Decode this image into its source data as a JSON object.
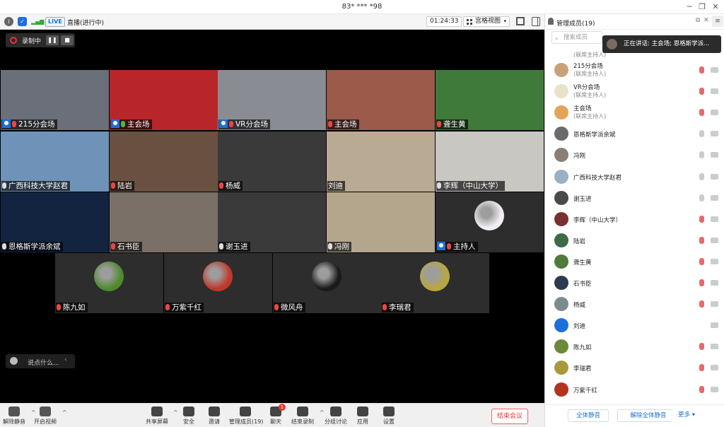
{
  "window": {
    "title": "83* *** *98"
  },
  "topbar": {
    "live_badge": "LIVE",
    "live_status": "直播(进行中)",
    "timer": "01:24:33",
    "view_mode": "宫格视图"
  },
  "recording": {
    "label": "录制中"
  },
  "tiles": [
    {
      "label": "215分会场",
      "host": true,
      "mic": "red",
      "bg": "#6b6f7a"
    },
    {
      "label": "主会场",
      "host": true,
      "mic": "green",
      "bg": "#b8262a"
    },
    {
      "label": "VR分会场",
      "host": true,
      "mic": "red",
      "bg": "#8a8c93"
    },
    {
      "label": "主会场",
      "host": false,
      "mic": "red",
      "bg": "#9c5a4a"
    },
    {
      "label": "聋生黄",
      "host": false,
      "mic": "red",
      "bg": "#3f7a3a"
    },
    {
      "label": "广西科技大学赵君",
      "host": false,
      "mic": "white",
      "bg": "#6f93b8"
    },
    {
      "label": "陆岩",
      "host": false,
      "mic": "red",
      "bg": "#6a5040"
    },
    {
      "label": "杨威",
      "host": false,
      "mic": "red",
      "bg": "#3a3a3a"
    },
    {
      "label": "刘迪",
      "host": false,
      "mic": "none",
      "bg": "#b9aa94"
    },
    {
      "label": "李辉（中山大学）",
      "host": false,
      "mic": "white",
      "bg": "#c9c7c2"
    },
    {
      "label": "恩格斯学派余斌",
      "host": false,
      "mic": "white",
      "bg": "#12243f"
    },
    {
      "label": "石书臣",
      "host": false,
      "mic": "red",
      "bg": "#7a7068"
    },
    {
      "label": "谢玉进",
      "host": false,
      "mic": "white",
      "bg": "#3a3a3a"
    },
    {
      "label": "冯刚",
      "host": false,
      "mic": "white",
      "bg": "#b4a68d"
    },
    {
      "label": "主持人",
      "host": true,
      "mic": "red",
      "bg": "#2d2d2d"
    },
    {
      "label": "陈九如",
      "host": false,
      "mic": "red",
      "bg": "#2d2d2d"
    },
    {
      "label": "万紫千红",
      "host": false,
      "mic": "red",
      "bg": "#2d2d2d"
    },
    {
      "label": "微风舟",
      "host": false,
      "mic": "red",
      "bg": "#2d2d2d"
    },
    {
      "label": "李瑞君",
      "host": false,
      "mic": "red",
      "bg": "#2d2d2d"
    }
  ],
  "chat": {
    "placeholder": "说点什么..."
  },
  "toolbar": [
    {
      "label": "解除静音",
      "icon": "mic-off-icon"
    },
    {
      "label": "开启视频",
      "icon": "camera-off-icon"
    },
    {
      "label": "共享屏幕",
      "icon": "share-screen-icon"
    },
    {
      "label": "安全",
      "icon": "shield-icon"
    },
    {
      "label": "邀请",
      "icon": "invite-icon"
    },
    {
      "label": "管理成员(19)",
      "icon": "members-icon"
    },
    {
      "label": "聊天",
      "icon": "chat-icon",
      "badge": "1"
    },
    {
      "label": "结束录制",
      "icon": "stop-record-icon"
    },
    {
      "label": "分组讨论",
      "icon": "breakout-icon"
    },
    {
      "label": "应用",
      "icon": "apps-icon"
    },
    {
      "label": "设置",
      "icon": "gear-icon"
    }
  ],
  "end_meeting": "结束会议",
  "panel": {
    "title": "管理成员(19)",
    "search_placeholder": "搜索成员",
    "toast": "正在讲话: 主会场; 恩格斯学派...",
    "top_partial_role": "(联席主持人)",
    "members": [
      {
        "name": "215分会场",
        "role": "(联席主持人)",
        "mic": "muted",
        "av": "#c9a27a"
      },
      {
        "name": "VR分会场",
        "role": "(联席主持人)",
        "mic": "muted",
        "av": "#e8e3c8"
      },
      {
        "name": "主会场",
        "role": "(联席主持人)",
        "mic": "muted",
        "av": "#e3a45a"
      },
      {
        "name": "恩格斯学派余斌",
        "role": "",
        "mic": "on",
        "av": "#6b6b6b"
      },
      {
        "name": "冯刚",
        "role": "",
        "mic": "on",
        "av": "#8a7f74"
      },
      {
        "name": "广西科技大学赵君",
        "role": "",
        "mic": "on",
        "av": "#9ab0c4"
      },
      {
        "name": "谢玉进",
        "role": "",
        "mic": "on",
        "av": "#4a4a4a"
      },
      {
        "name": "李辉（中山大学）",
        "role": "",
        "mic": "muted",
        "av": "#7a3030"
      },
      {
        "name": "陆岩",
        "role": "",
        "mic": "muted",
        "av": "#3d6b45"
      },
      {
        "name": "聋生黄",
        "role": "",
        "mic": "muted",
        "av": "#4f7a3a"
      },
      {
        "name": "石书臣",
        "role": "",
        "mic": "muted",
        "av": "#2c3a52"
      },
      {
        "name": "杨威",
        "role": "",
        "mic": "muted",
        "av": "#7d8a8e"
      },
      {
        "name": "刘迪",
        "role": "",
        "mic": "none",
        "av": "#1e6fd9"
      },
      {
        "name": "陈九如",
        "role": "",
        "mic": "muted",
        "av": "#6a8a3a"
      },
      {
        "name": "李瑞君",
        "role": "",
        "mic": "muted",
        "av": "#a89a3a"
      },
      {
        "name": "万紫千红",
        "role": "",
        "mic": "muted",
        "av": "#b2331f"
      }
    ],
    "footer": {
      "mute_all": "全体静音",
      "unmute_all": "解除全体静音",
      "more": "更多 ▾"
    }
  }
}
